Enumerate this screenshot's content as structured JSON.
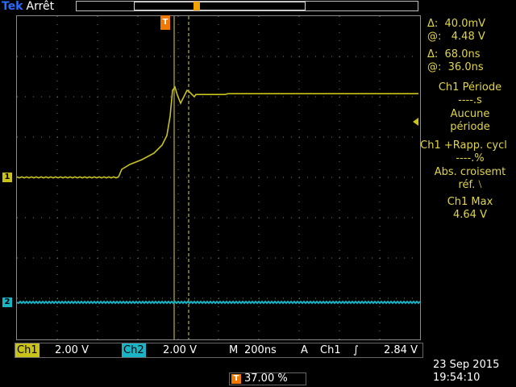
{
  "header": {
    "brand": "Tek",
    "status": "Arrêt"
  },
  "markers": {
    "ch1": "1",
    "ch2": "2",
    "trigger": "T"
  },
  "cursors": {
    "delta_v": "Δ:  40.0mV",
    "at_v": "@:   4.48 V",
    "delta_t": "Δ:  68.0ns",
    "at_t": "@:  36.0ns"
  },
  "measurements": {
    "period_title": "Ch1 Période",
    "period_value": "----.s",
    "period_note1": "Aucune",
    "period_note2": "période",
    "duty_title": "Ch1 +Rapp. cycl",
    "duty_value": "----.%",
    "duty_note1": "Abs. croisemt",
    "duty_note2": "réf. ⧵",
    "max_title": "Ch1 Max",
    "max_value": "4.64 V"
  },
  "bottom": {
    "ch1_label": "Ch1",
    "ch1_scale": "2.00 V",
    "ch2_label": "Ch2",
    "ch2_scale": "2.00 V",
    "timebase_label": "M",
    "timebase_value": "200ns",
    "trigger_label": "A",
    "trigger_source": "Ch1",
    "trigger_slope": "∫",
    "trigger_level": "2.84 V",
    "position": "37.00 %",
    "date": "23 Sep  2015",
    "time": "19:54:10"
  },
  "colors": {
    "ch1": "#c9c21a",
    "ch2": "#19b4c5",
    "trigger": "#f07a00",
    "readout": "#e0d54a"
  }
}
